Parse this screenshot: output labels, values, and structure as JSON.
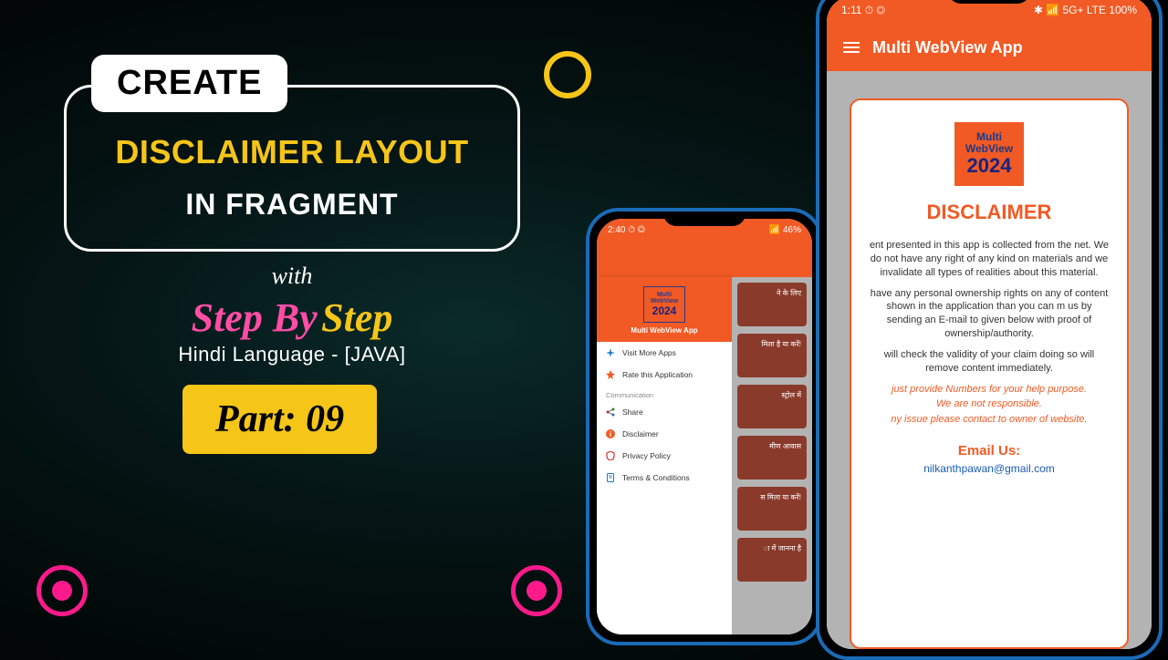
{
  "title": {
    "create": "CREATE",
    "line1": "DISCLAIMER LAYOUT",
    "line2": "IN FRAGMENT",
    "with": "with",
    "step_pink": "Step By",
    "step_yellow": "Step",
    "subtitle": "Hindi Language - [JAVA]",
    "part": "Part: 09"
  },
  "small_phone": {
    "status_left": "2:40  ⏱ ◎",
    "status_right": "📶 46%",
    "drawer_logo_line1": "Multi",
    "drawer_logo_line2": "WebView",
    "drawer_logo_year": "2024",
    "drawer_title": "Multi WebView App",
    "items_top": [
      "Visit More Apps",
      "Rate this Application"
    ],
    "section": "Communication",
    "items_comm": [
      "Share",
      "Disclaimer",
      "Privacy Policy",
      "Terms & Conditions"
    ],
    "cards": [
      "ने के लिए",
      "मिला है या करें!",
      "स्ट्रोल में",
      "मीण आवास",
      "स मिला या करें!",
      "ा में जानना है"
    ]
  },
  "large_phone": {
    "status_left": "1:11  ⏱ ◎",
    "status_right": "✱ 📶 5G+ LTE  100%",
    "app_title": "Multi WebView App",
    "logo_line1": "Multi",
    "logo_line2": "WebView",
    "logo_year": "2024",
    "heading": "DISCLAIMER",
    "para1": "ent presented in this app is collected from the net. We do not have any right of any kind on materials and we invalidate all types of realities about this material.",
    "para2": "have any personal ownership rights on any of content shown in the application than you can m us by sending an E-mail to given below with proof of ownership/authority.",
    "para3": "will check the validity of your claim doing so will remove content immediately.",
    "orange1": "just provide Numbers for your help purpose.",
    "orange2": "We are not responsible.",
    "orange3": "ny issue please contact to owner of website.",
    "email_label": "Email Us:",
    "email": "nilkanthpawan@gmail.com"
  }
}
